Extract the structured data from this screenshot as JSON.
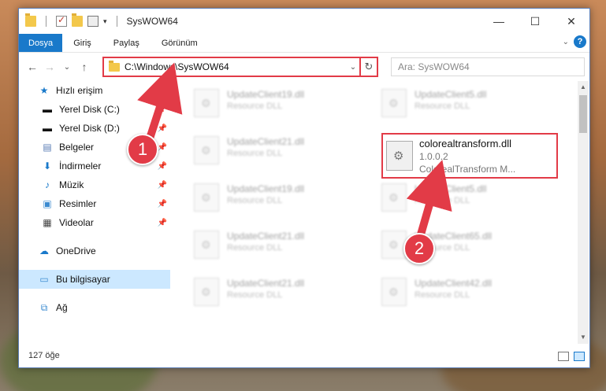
{
  "window": {
    "title": "SysWOW64",
    "controls": {
      "minimize": "—",
      "maximize": "☐",
      "close": "✕"
    }
  },
  "ribbon": {
    "tabs": [
      "Dosya",
      "Giriş",
      "Paylaş",
      "Görünüm"
    ],
    "active_tab": "Dosya"
  },
  "navigation": {
    "back": "←",
    "forward": "→",
    "recent": "⌄",
    "up": "↑"
  },
  "address_bar": {
    "path": "C:\\Windows\\SysWOW64"
  },
  "search": {
    "placeholder": "Ara: SysWOW64"
  },
  "sidebar": {
    "items": [
      {
        "label": "Hızlı erişim",
        "icon": "star-icon",
        "pinned": false
      },
      {
        "label": "Yerel Disk (C:)",
        "icon": "drive-icon",
        "pinned": true
      },
      {
        "label": "Yerel Disk (D:)",
        "icon": "drive-icon",
        "pinned": true
      },
      {
        "label": "Belgeler",
        "icon": "document-icon",
        "pinned": true
      },
      {
        "label": "İndirmeler",
        "icon": "download-icon",
        "pinned": true
      },
      {
        "label": "Müzik",
        "icon": "music-icon",
        "pinned": true
      },
      {
        "label": "Resimler",
        "icon": "pictures-icon",
        "pinned": true
      },
      {
        "label": "Videolar",
        "icon": "video-icon",
        "pinned": true
      },
      {
        "label": "OneDrive",
        "icon": "cloud-icon",
        "pinned": false
      },
      {
        "label": "Bu bilgisayar",
        "icon": "computer-icon",
        "pinned": false,
        "selected": true
      },
      {
        "label": "Ağ",
        "icon": "network-icon",
        "pinned": false
      }
    ]
  },
  "files": [
    {
      "name": "UpdateClient19.dll",
      "desc": "Resource DLL"
    },
    {
      "name": "UpdateClient5.dll",
      "desc": "Resource DLL"
    },
    {
      "name": "UpdateClient21.dll",
      "desc": "Resource DLL"
    },
    {
      "name": "UpdateClient19.dll",
      "desc": "Resource DLL"
    },
    {
      "name": "UpdateClient5.dll",
      "desc": "Resource DLL"
    },
    {
      "name": "UpdateClient21.dll",
      "desc": "Resource DLL"
    },
    {
      "name": "UpdateClient65.dll",
      "desc": "Resource DLL"
    },
    {
      "name": "UpdateClient21.dll",
      "desc": "Resource DLL"
    },
    {
      "name": "UpdateClient42.dll",
      "desc": "Resource DLL"
    }
  ],
  "highlighted_file": {
    "name": "colorealtransform.dll",
    "version": "1.0.0.2",
    "description": "ColorealTransform M..."
  },
  "status": {
    "item_count": "127 öğe"
  },
  "annotations": {
    "badge1": "1",
    "badge2": "2",
    "accent": "#e23b47"
  }
}
